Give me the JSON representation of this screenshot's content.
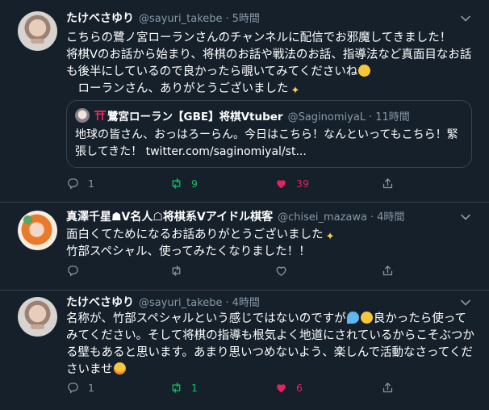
{
  "tweets": [
    {
      "name": "たけべさゆり",
      "handle": "@sayuri_takebe",
      "time": "5時間",
      "body_1": "こちらの鷺ノ宮ローランさんのチャンネルに配信でお邪魔してきました！\n将棋Vのお話から始まり、将棋のお話や戦法のお話、指導法など真面目なお話も後半にしているので良かったら覗いてみてくださいね",
      "body_1_emoji": "smiling-face-with-open-mouth-emoji",
      "body_2": "　ローランさん、ありがとうございました",
      "body_2_emoji": "sparkles-emoji",
      "quote": {
        "name": "鷺宮ローラン【GBE】将棋Vtuber",
        "name_prefix_icon": "torii-gate-icon",
        "handle": "@SaginomiyaL",
        "time": "11時間",
        "body": "地球の皆さん、おっはろーらん。今日はこちら！なんといってもこちら！緊張してきた！ twitter.com/saginomiyal/st..."
      },
      "replies": "1",
      "retweets": "9",
      "likes": "39",
      "retweeted": true,
      "liked": true
    },
    {
      "name": "真澤千星☗V名人☖将棋系Vアイドル棋客",
      "handle": "@chisei_mazawa",
      "time": "4時間",
      "body_1": "面白くてためになるお話ありがとうございました",
      "body_1_emoji": "sparkles-emoji",
      "body_2": "竹部スペシャル、使ってみたくなりました！！",
      "replies": "",
      "retweets": "",
      "likes": "",
      "retweeted": false,
      "liked": false
    },
    {
      "name": "たけべさゆり",
      "handle": "@sayuri_takebe",
      "time": "4時間",
      "body_1": "名称が、竹部スペシャルという感じではないのですが",
      "body_1_emoji": "sweat-droplets-emoji",
      "body_1b_emoji": "grinning-face-with-sweat-emoji",
      "body_1b": "良かったら使ってみてください。そして将棋の指導も根気よく地道にされているからこそぶつかる壁もあると思います。あまり思いつめないよう、楽しんで活動なさってくださいませ",
      "body_1c_emoji": "smiling-face-with-smiling-eyes-emoji",
      "replies": "1",
      "retweets": "1",
      "likes": "6",
      "retweeted": true,
      "liked": true
    }
  ],
  "separator": "·",
  "colors": {
    "background": "#15202b",
    "border": "#38444d",
    "muted": "#8899a6",
    "retweet_active": "#17bf63",
    "like_active": "#e0245e",
    "torii": "#e0245e"
  }
}
